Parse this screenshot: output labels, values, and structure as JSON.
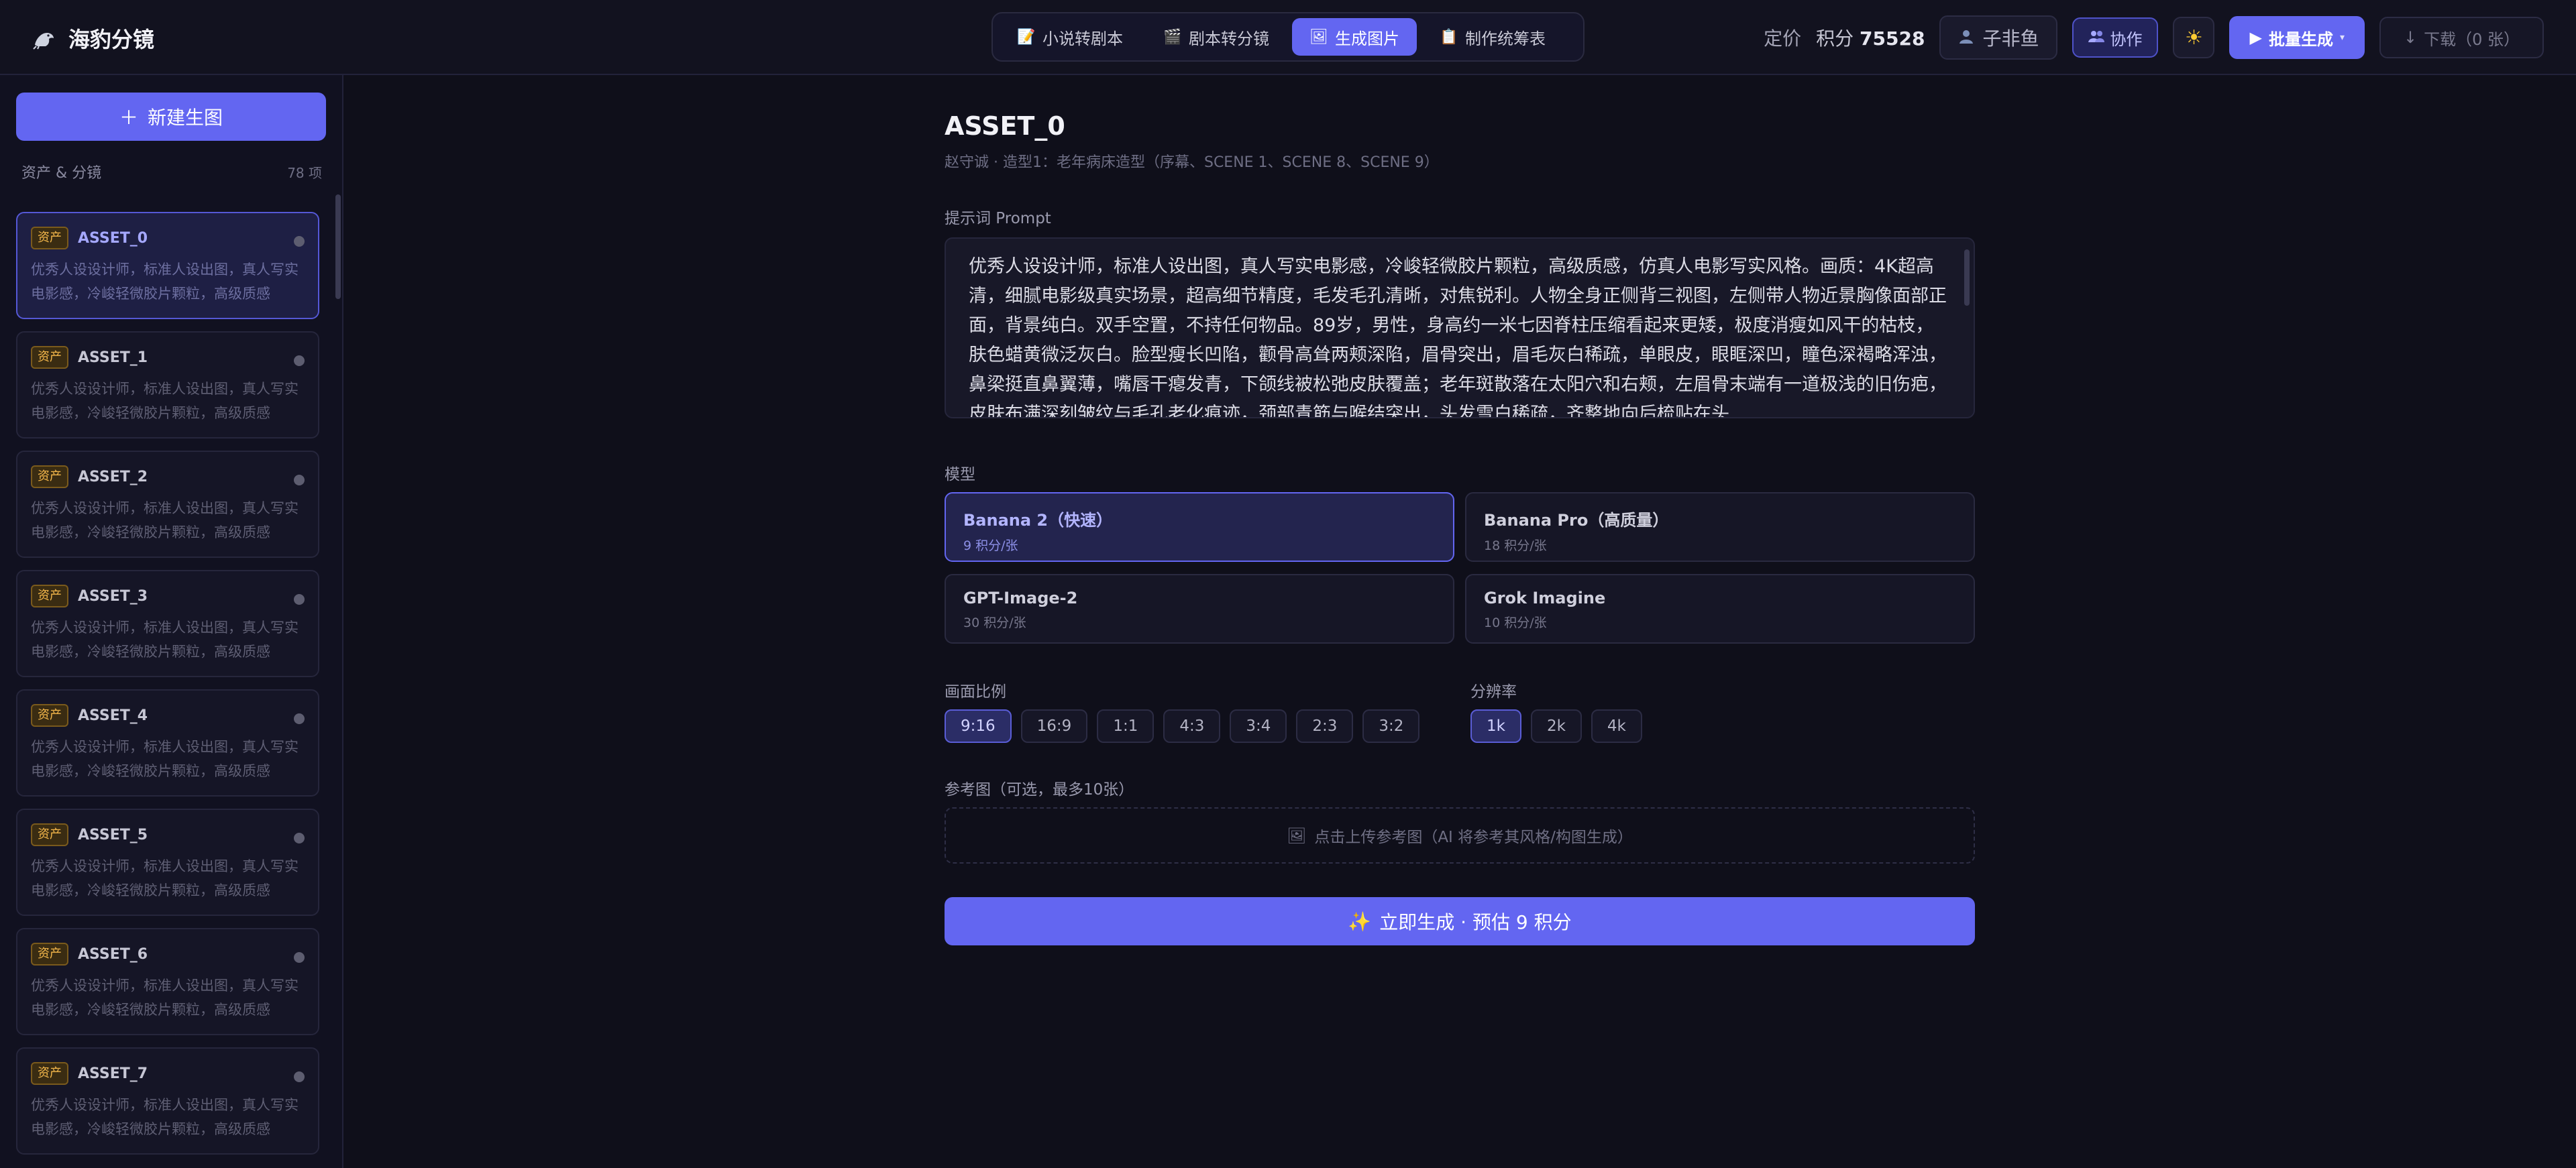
{
  "app": {
    "title": "海豹分镜",
    "logo_icon": "seal-icon"
  },
  "nav": {
    "tabs": [
      {
        "label": "小说转剧本",
        "icon": "document-icon"
      },
      {
        "label": "剧本转分镜",
        "icon": "clapperboard-icon"
      },
      {
        "label": "生成图片",
        "icon": "image-icon",
        "active": true
      },
      {
        "label": "制作统筹表",
        "icon": "clipboard-icon"
      }
    ]
  },
  "header": {
    "price_label": "定价",
    "credits_label": "积分",
    "credits_value": "75528",
    "user_name": "子非鱼",
    "collab_label": "协作",
    "batch_label": "批量生成",
    "download_label": "下载（0 张）"
  },
  "sidebar": {
    "new_button": "新建生图",
    "section_title": "资产 & 分镜",
    "count": "78 项",
    "assets": [
      {
        "badge": "资产",
        "name": "ASSET_0",
        "desc": "优秀人设设计师，标准人设出图，真人写实电影感，冷峻轻微胶片颗粒，高级质感",
        "active": true
      },
      {
        "badge": "资产",
        "name": "ASSET_1",
        "desc": "优秀人设设计师，标准人设出图，真人写实电影感，冷峻轻微胶片颗粒，高级质感"
      },
      {
        "badge": "资产",
        "name": "ASSET_2",
        "desc": "优秀人设设计师，标准人设出图，真人写实电影感，冷峻轻微胶片颗粒，高级质感"
      },
      {
        "badge": "资产",
        "name": "ASSET_3",
        "desc": "优秀人设设计师，标准人设出图，真人写实电影感，冷峻轻微胶片颗粒，高级质感"
      },
      {
        "badge": "资产",
        "name": "ASSET_4",
        "desc": "优秀人设设计师，标准人设出图，真人写实电影感，冷峻轻微胶片颗粒，高级质感"
      },
      {
        "badge": "资产",
        "name": "ASSET_5",
        "desc": "优秀人设设计师，标准人设出图，真人写实电影感，冷峻轻微胶片颗粒，高级质感"
      },
      {
        "badge": "资产",
        "name": "ASSET_6",
        "desc": "优秀人设设计师，标准人设出图，真人写实电影感，冷峻轻微胶片颗粒，高级质感"
      },
      {
        "badge": "资产",
        "name": "ASSET_7",
        "desc": "优秀人设设计师，标准人设出图，真人写实电影感，冷峻轻微胶片颗粒，高级质感"
      }
    ]
  },
  "main": {
    "asset_title": "ASSET_0",
    "asset_subtitle": "赵守诚 · 造型1：老年病床造型（序幕、SCENE 1、SCENE 8、SCENE 9）",
    "prompt_label": "提示词 Prompt",
    "prompt_text": "优秀人设设计师，标准人设出图，真人写实电影感，冷峻轻微胶片颗粒，高级质感，仿真人电影写实风格。画质：4K超高清，细腻电影级真实场景，超高细节精度，毛发毛孔清晰，对焦锐利。人物全身正侧背三视图，左侧带人物近景胸像面部正面，背景纯白。双手空置，不持任何物品。89岁，男性，身高约一米七因脊柱压缩看起来更矮，极度消瘦如风干的枯枝，肤色蜡黄微泛灰白。脸型瘦长凹陷，颧骨高耸两颊深陷，眉骨突出，眉毛灰白稀疏，单眼皮，眼眶深凹，瞳色深褐略浑浊，鼻梁挺直鼻翼薄，嘴唇干瘪发青，下颌线被松弛皮肤覆盖；老年斑散落在太阳穴和右颊，左眉骨末端有一道极浅的旧伤疤，皮肤布满深刻皱纹与毛孔老化痕迹，颈部青筋与喉结突出，头发雪白稀疏，齐整地向后梳贴在头",
    "model_label": "模型",
    "models": [
      {
        "name": "Banana 2（快速）",
        "price": "9 积分/张",
        "active": true
      },
      {
        "name": "Banana Pro（高质量）",
        "price": "18 积分/张"
      },
      {
        "name": "GPT-Image-2",
        "price": "30 积分/张"
      },
      {
        "name": "Grok Imagine",
        "price": "10 积分/张"
      }
    ],
    "ratio_label": "画面比例",
    "ratios": [
      "9:16",
      "16:9",
      "1:1",
      "4:3",
      "3:4",
      "2:3",
      "3:2"
    ],
    "ratio_selected": "9:16",
    "resolution_label": "分辨率",
    "resolutions": [
      "1k",
      "2k",
      "4k"
    ],
    "resolution_selected": "1k",
    "reference_label": "参考图（可选，最多10张）",
    "upload_text": "点击上传参考图（AI 将参考其风格/构图生成）",
    "generate_label": "立即生成 · 预估 9 积分"
  },
  "colors": {
    "accent": "#6366f1",
    "background": "#0f0f1a",
    "badge": "#f5b84b"
  }
}
